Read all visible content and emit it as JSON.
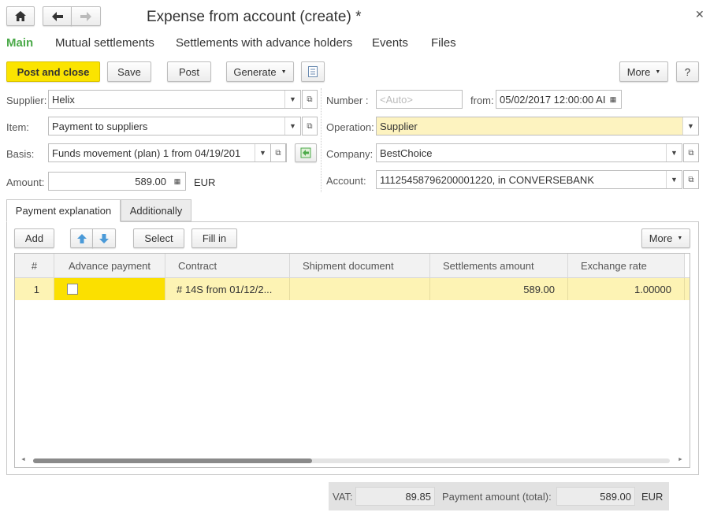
{
  "window": {
    "title": "Expense from account (create) *"
  },
  "nav_tabs": [
    "Main",
    "Mutual settlements",
    "Settlements with advance holders",
    "Events",
    "Files"
  ],
  "toolbar": {
    "post_close": "Post and close",
    "save": "Save",
    "post": "Post",
    "generate": "Generate",
    "more": "More",
    "help": "?"
  },
  "form": {
    "supplier_label": "Supplier:",
    "supplier": "Helix",
    "item_label": "Item:",
    "item": "Payment to suppliers",
    "basis_label": "Basis:",
    "basis": "Funds movement (plan) 1 from 04/19/201",
    "amount_label": "Amount:",
    "amount": "589.00",
    "currency": "EUR",
    "number_label": "Number :",
    "number_placeholder": "<Auto>",
    "from_label": "from:",
    "date": "05/02/2017 12:00:00 AI",
    "operation_label": "Operation:",
    "operation": "Supplier",
    "company_label": "Company:",
    "company": "BestChoice",
    "account_label": "Account:",
    "account": "11125458796200001220, in CONVERSEBANK"
  },
  "subtabs": [
    "Payment explanation",
    "Additionally"
  ],
  "table_toolbar": {
    "add": "Add",
    "select": "Select",
    "fill_in": "Fill in",
    "more": "More"
  },
  "table": {
    "columns": [
      "#",
      "Advance payment",
      "Contract",
      "Shipment document",
      "Settlements amount",
      "Exchange rate"
    ],
    "rows": [
      {
        "num": "1",
        "advance": false,
        "contract": "# 14S from 01/12/2...",
        "shipment": "",
        "amount": "589.00",
        "rate": "1.00000"
      }
    ]
  },
  "footer": {
    "vat_label": "VAT:",
    "vat": "89.85",
    "total_label": "Payment amount (total):",
    "total": "589.00",
    "currency": "EUR"
  }
}
